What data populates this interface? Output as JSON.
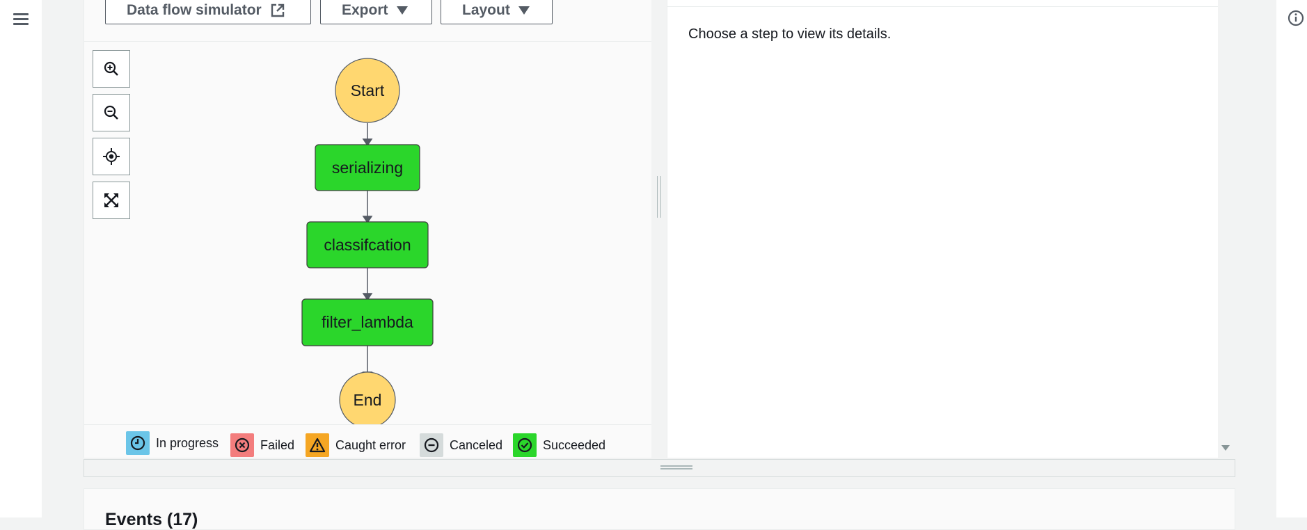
{
  "toolbar": {
    "data_flow_simulator_label": "Data flow simulator",
    "export_label": "Export",
    "layout_label": "Layout"
  },
  "zoom_controls": [
    "zoom-in-icon",
    "zoom-out-icon",
    "center-icon",
    "fit-to-screen-icon"
  ],
  "graph": {
    "nodes": [
      {
        "label": "Start",
        "shape": "circle",
        "color": "#ffd770"
      },
      {
        "label": "serializing",
        "shape": "rect",
        "color": "#2bd62b"
      },
      {
        "label": "classifcation",
        "shape": "rect",
        "color": "#2bd62b"
      },
      {
        "label": "filter_lambda",
        "shape": "rect",
        "color": "#2bd62b"
      },
      {
        "label": "End",
        "shape": "circle",
        "color": "#ffd770"
      }
    ]
  },
  "legend": {
    "in_progress": {
      "label": "In progress",
      "color": "#6bc5e8",
      "icon": "clock-icon"
    },
    "failed": {
      "label": "Failed",
      "color": "#f37d7d",
      "icon": "x-circle-icon"
    },
    "caught_error": {
      "label": "Caught error",
      "color": "#f5a623",
      "icon": "warning-icon"
    },
    "canceled": {
      "label": "Canceled",
      "color": "#d5dbdb",
      "icon": "minus-circle-icon"
    },
    "succeeded": {
      "label": "Succeeded",
      "color": "#2bd62b",
      "icon": "check-circle-icon"
    }
  },
  "details": {
    "empty_text": "Choose a step to view its details."
  },
  "events": {
    "title": "Events (17)"
  }
}
